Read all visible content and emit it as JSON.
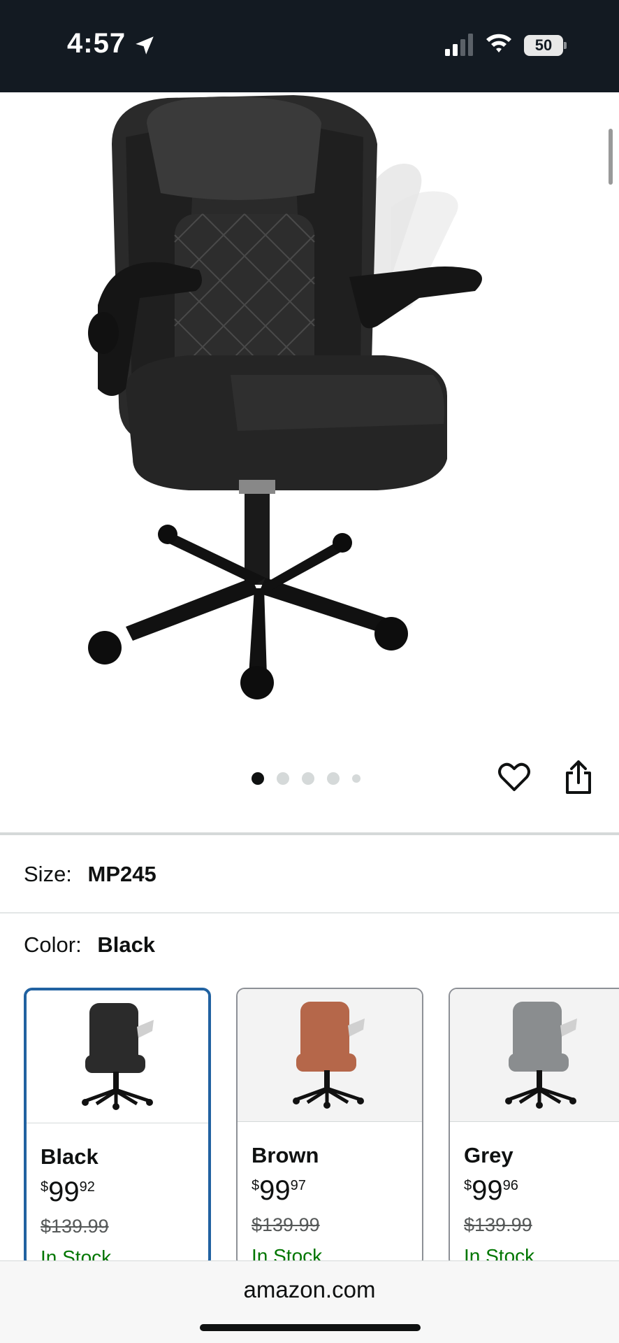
{
  "status_bar": {
    "time": "4:57",
    "battery": "50"
  },
  "carousel": {
    "dot_count": 5,
    "active_index": 0
  },
  "size": {
    "label": "Size:",
    "value": "MP245"
  },
  "color": {
    "label": "Color:",
    "value": "Black"
  },
  "swatches": [
    {
      "name": "Black",
      "price_currency": "$",
      "price_whole": "99",
      "price_fraction": "92",
      "list_price": "$139.99",
      "availability": "In Stock",
      "chair_color": "#2b2b2b"
    },
    {
      "name": "Brown",
      "price_currency": "$",
      "price_whole": "99",
      "price_fraction": "97",
      "list_price": "$139.99",
      "availability": "In Stock",
      "chair_color": "#b5674a"
    },
    {
      "name": "Grey",
      "price_currency": "$",
      "price_whole": "99",
      "price_fraction": "96",
      "list_price": "$139.99",
      "availability": "In Stock",
      "chair_color": "#8a8d8f"
    }
  ],
  "url_bar": {
    "domain": "amazon.com"
  },
  "colors": {
    "status_bar_bg": "#131a22",
    "selected_border": "#2162a1",
    "in_stock": "#007600"
  },
  "icons": {
    "favorite": "heart-icon",
    "share": "share-icon",
    "location": "location-arrow-icon",
    "signal": "cellular-signal-icon",
    "wifi": "wifi-icon"
  }
}
